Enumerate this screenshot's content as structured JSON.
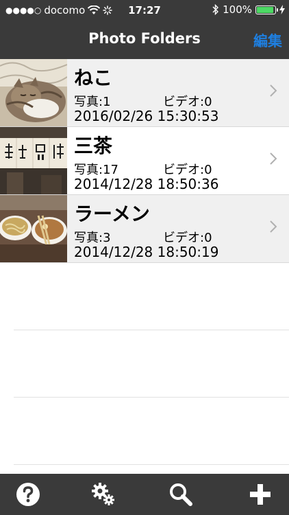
{
  "status_bar": {
    "carrier": "docomo",
    "time": "17:27",
    "battery": "100%",
    "colors": {
      "battery_fill": "#4cd964"
    }
  },
  "nav": {
    "title": "Photo Folders",
    "edit_label": "編集",
    "colors": {
      "background": "#3a3a3a",
      "edit": "#1e7fe0"
    }
  },
  "folders": [
    {
      "name": "ねこ",
      "photos": "写真:1",
      "videos": "ビデオ:0",
      "date": "2016/02/26 15:30:53",
      "thumbnail": "cat-photo"
    },
    {
      "name": "三茶",
      "photos": "写真:17",
      "videos": "ビデオ:0",
      "date": "2014/12/28 18:50:36",
      "thumbnail": "shop-sign-photo"
    },
    {
      "name": "ラーメン",
      "photos": "写真:3",
      "videos": "ビデオ:0",
      "date": "2014/12/28 18:50:19",
      "thumbnail": "ramen-photo"
    }
  ],
  "toolbar": {
    "items": [
      "help-icon",
      "settings-icon",
      "search-icon",
      "add-icon"
    ]
  }
}
